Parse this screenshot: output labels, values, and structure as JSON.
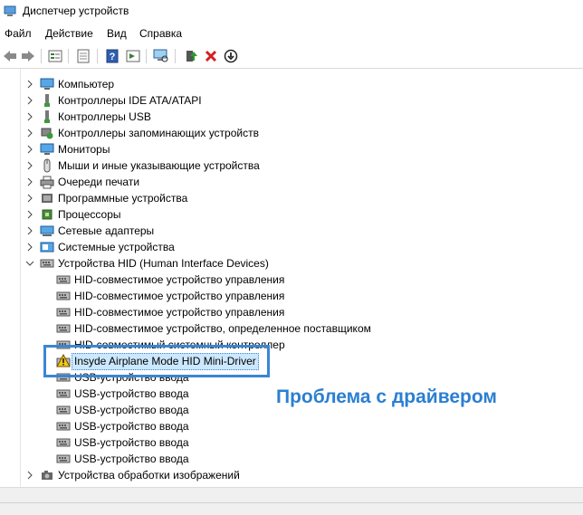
{
  "window": {
    "title": "Диспетчер устройств"
  },
  "menu": [
    "Файл",
    "Действие",
    "Вид",
    "Справка"
  ],
  "toolbar": [
    "back-icon",
    "forward-icon",
    "properties-icon",
    "list-icon",
    "help-icon",
    "view-icon",
    "scan-icon",
    "update-driver-icon",
    "uninstall-icon",
    "disable-icon"
  ],
  "tree": {
    "categories": [
      {
        "label": "Компьютер",
        "icon": "computer-icon"
      },
      {
        "label": "Контроллеры IDE ATA/ATAPI",
        "icon": "ide-icon"
      },
      {
        "label": "Контроллеры USB",
        "icon": "usb-icon"
      },
      {
        "label": "Контроллеры запоминающих устройств",
        "icon": "storage-icon"
      },
      {
        "label": "Мониторы",
        "icon": "monitor-icon"
      },
      {
        "label": "Мыши и иные указывающие устройства",
        "icon": "mouse-icon"
      },
      {
        "label": "Очереди печати",
        "icon": "printer-icon"
      },
      {
        "label": "Программные устройства",
        "icon": "software-icon"
      },
      {
        "label": "Процессоры",
        "icon": "cpu-icon"
      },
      {
        "label": "Сетевые адаптеры",
        "icon": "network-icon"
      },
      {
        "label": "Системные устройства",
        "icon": "system-icon"
      },
      {
        "label": "Устройства HID (Human Interface Devices)",
        "icon": "hid-icon"
      }
    ],
    "hid_children": [
      {
        "label": "HID-совместимое устройство управления",
        "warning": false
      },
      {
        "label": "HID-совместимое устройство управления",
        "warning": false
      },
      {
        "label": "HID-совместимое устройство управления",
        "warning": false
      },
      {
        "label": "HID-совместимое устройство, определенное поставщиком",
        "warning": false
      },
      {
        "label": "HID-совместимый системный контроллер",
        "warning": false
      },
      {
        "label": "Insyde Airplane Mode HID Mini-Driver",
        "warning": true
      },
      {
        "label": "USB-устройство ввода",
        "warning": false
      },
      {
        "label": "USB-устройство ввода",
        "warning": false
      },
      {
        "label": "USB-устройство ввода",
        "warning": false
      },
      {
        "label": "USB-устройство ввода",
        "warning": false
      },
      {
        "label": "USB-устройство ввода",
        "warning": false
      },
      {
        "label": "USB-устройство ввода",
        "warning": false
      }
    ],
    "last_category": {
      "label": "Устройства обработки изображений",
      "icon": "imaging-icon"
    }
  },
  "annotation": {
    "text": "Проблема с драйвером"
  },
  "colors": {
    "highlight_border": "#3a86d4",
    "annotation": "#2b7fd1",
    "selection": "#cce8ff"
  }
}
